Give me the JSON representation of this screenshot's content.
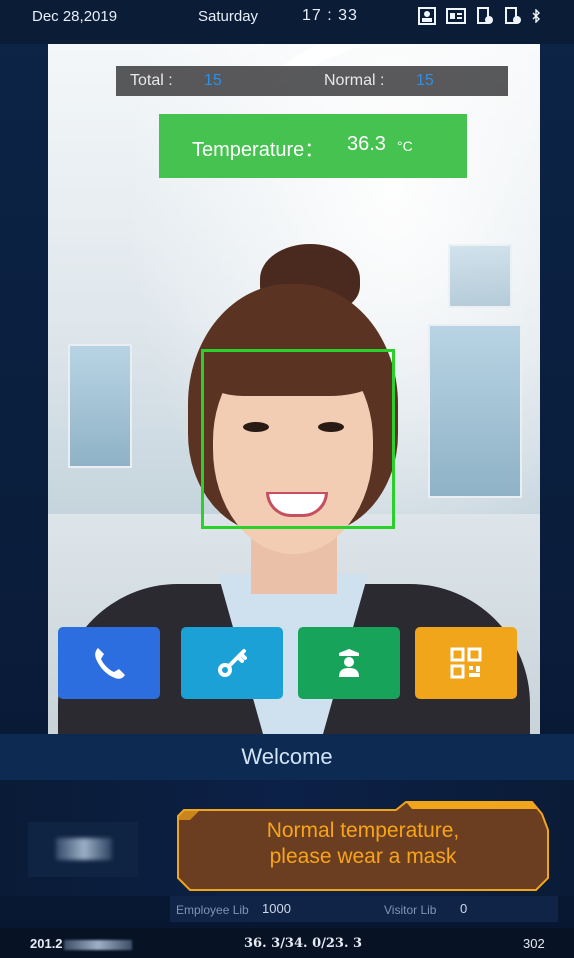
{
  "status_bar": {
    "date": "Dec 28,2019",
    "day": "Saturday",
    "time": "17 : 33",
    "icons": [
      "face-recognition-icon",
      "id-card-icon",
      "lock-info-icon",
      "lock-status-icon",
      "bluetooth-icon"
    ]
  },
  "counter": {
    "total_label": "Total :",
    "total_value": "15",
    "normal_label": "Normal :",
    "normal_value": "15"
  },
  "temperature": {
    "label": "Temperature：",
    "value": "36.3",
    "unit": "°C"
  },
  "actions": [
    {
      "name": "call",
      "icon": "phone-icon",
      "color": "#2c6de0"
    },
    {
      "name": "unlock",
      "icon": "key-icon",
      "color": "#1ba1d6"
    },
    {
      "name": "guard",
      "icon": "security-guard-icon",
      "color": "#18a35a"
    },
    {
      "name": "qr",
      "icon": "qr-code-icon",
      "color": "#f0a51b"
    }
  ],
  "welcome": "Welcome",
  "message": {
    "line1": "Normal temperature,",
    "line2": "please wear a mask"
  },
  "library": {
    "employee_label": "Employee Lib",
    "employee_value": "1000",
    "visitor_label": "Visitor Lib",
    "visitor_value": "0"
  },
  "bottom": {
    "ip_prefix": "201.2",
    "temps": "36. 3/34. 0/23. 3",
    "count": "302"
  },
  "colors": {
    "face_box": "#2bd12b",
    "temperature_bg": "#45c24f",
    "message_text": "#f7a419"
  }
}
